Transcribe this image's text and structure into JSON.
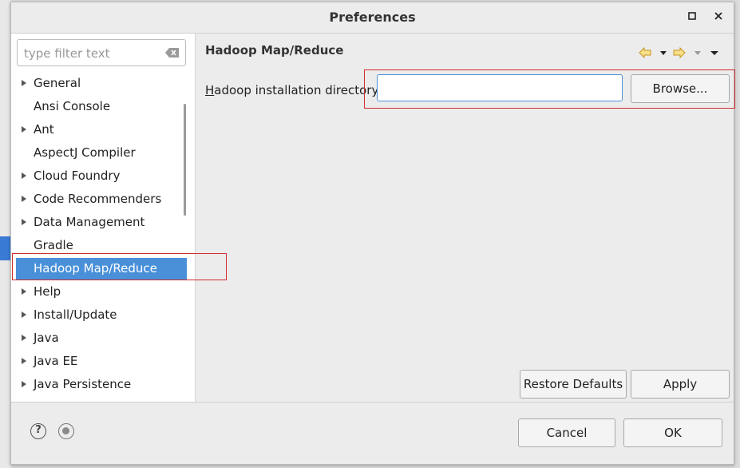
{
  "dialog": {
    "title": "Preferences",
    "maximize_icon": "maximize-icon",
    "close_icon": "close-icon"
  },
  "sidebar": {
    "filter_placeholder": "type filter text",
    "items": [
      {
        "label": "General",
        "expandable": true
      },
      {
        "label": "Ansi Console",
        "expandable": false
      },
      {
        "label": "Ant",
        "expandable": true
      },
      {
        "label": "AspectJ Compiler",
        "expandable": false
      },
      {
        "label": "Cloud Foundry",
        "expandable": true
      },
      {
        "label": "Code Recommenders",
        "expandable": true
      },
      {
        "label": "Data Management",
        "expandable": true
      },
      {
        "label": "Gradle",
        "expandable": false
      },
      {
        "label": "Hadoop Map/Reduce",
        "expandable": false,
        "selected": true
      },
      {
        "label": "Help",
        "expandable": true
      },
      {
        "label": "Install/Update",
        "expandable": true
      },
      {
        "label": "Java",
        "expandable": true
      },
      {
        "label": "Java EE",
        "expandable": true
      },
      {
        "label": "Java Persistence",
        "expandable": true
      }
    ]
  },
  "page": {
    "title": "Hadoop Map/Reduce",
    "install_dir_label": "Hadoop installation directory:",
    "install_dir_value": "",
    "browse_label": "Browse...",
    "restore_defaults_label": "Restore Defaults",
    "apply_label": "Apply"
  },
  "footer": {
    "cancel_label": "Cancel",
    "ok_label": "OK"
  },
  "colors": {
    "selection": "#4a90d9",
    "highlight_box": "#d02c2c",
    "nav_arrow": "#e0a020"
  }
}
